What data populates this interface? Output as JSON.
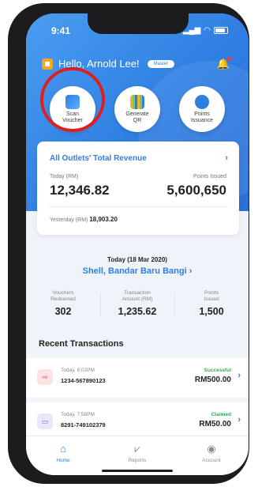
{
  "status_bar": {
    "time": "9:41"
  },
  "header": {
    "greeting": "Hello, Arnold Lee!",
    "role_badge": "Master"
  },
  "actions": [
    {
      "label": "Scan\nVoucher",
      "icon": "scan-voucher-icon"
    },
    {
      "label": "Generate\nQR",
      "icon": "qr-code-icon"
    },
    {
      "label": "Points\nIssuance",
      "icon": "points-icon"
    }
  ],
  "revenue_card": {
    "title": "All Outlets' Total Revenue",
    "today_label": "Today (RM)",
    "today_value": "12,346.82",
    "points_label": "Points Issued",
    "points_value": "5,600,650",
    "yesterday_label": "Yesterday (RM)",
    "yesterday_value": "18,903.20"
  },
  "outlet_summary": {
    "date": "Today (18 Mar 2020)",
    "outlet": "Shell, Bandar Baru Bangi",
    "stats": [
      {
        "label": "Vouchers\nRedeemed",
        "value": "302"
      },
      {
        "label": "Transaction\nAmount (RM)",
        "value": "1,235.62"
      },
      {
        "label": "Points\nIssued",
        "value": "1,500"
      }
    ]
  },
  "recent": {
    "title": "Recent Transactions",
    "items": [
      {
        "time": "Today, 8:02PM",
        "id": "1234-567890123",
        "status": "Successful",
        "amount": "RM500.00"
      },
      {
        "time": "Today, 7:58PM",
        "id": "8291-749102379",
        "status": "Claimed",
        "amount": "RM50.00"
      }
    ]
  },
  "tabs": [
    {
      "label": "Home",
      "active": true
    },
    {
      "label": "Reports",
      "active": false
    },
    {
      "label": "Account",
      "active": false
    }
  ],
  "colors": {
    "primary": "#2f7fe3",
    "highlight": "#e11d1d",
    "success": "#36a852"
  }
}
